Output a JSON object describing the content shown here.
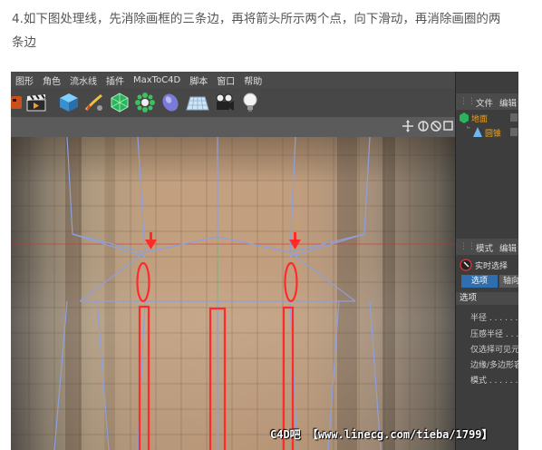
{
  "caption": {
    "line1": "4.如下图处理线，先消除画框的三条边，再将箭头所示两个点，向下滑动，再消除画圈的两",
    "line2": "条边"
  },
  "menu": {
    "items": [
      "图形",
      "角色",
      "流水线",
      "插件",
      "MaxToC4D",
      "脚本",
      "窗口",
      "帮助"
    ]
  },
  "toolbar": {
    "icons": [
      "clapper-icon",
      "cube-icon",
      "pen-icon",
      "subdivision-icon",
      "array-icon",
      "deformer-icon",
      "floor-icon",
      "camera-icon",
      "light-icon"
    ]
  },
  "object_manager": {
    "tabs": [
      "文件",
      "编辑"
    ],
    "items": [
      "地面",
      "圆锥"
    ]
  },
  "attribute_manager": {
    "tabs": [
      "模式",
      "编辑"
    ],
    "tool_name": "实时选择",
    "subtabs": [
      "选项",
      "轴向"
    ],
    "section": "选项",
    "fields": [
      "半径 . . . . . .",
      "压感半径 . . .",
      "仅选择可见元",
      "边缘/多边形容",
      "模式 . . . . . ."
    ]
  },
  "watermark": "C4D吧 【www.linecg.com/tieba/1799】",
  "colors": {
    "annotation_red": "#ff2a2a",
    "wire_blue": "#8da0dc",
    "ui_dark": "#3a3a3a",
    "object_orange": "#e8a020"
  }
}
